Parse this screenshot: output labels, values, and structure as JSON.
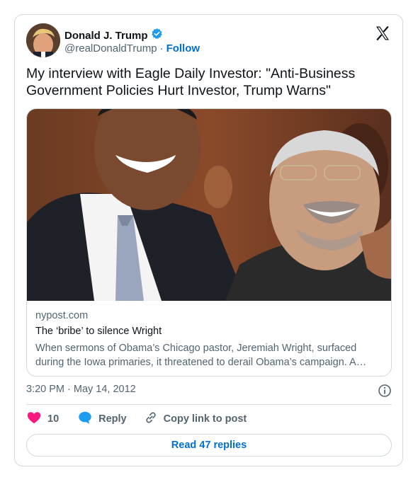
{
  "author": {
    "name": "Donald J. Trump",
    "handle": "@realDonaldTrump",
    "separator": "·",
    "follow_label": "Follow",
    "verified_color": "#1d9bf0"
  },
  "tweet": {
    "text": "My interview with Eagle Daily Investor: \"Anti-Business Government Policies Hurt Investor, Trump Warns\""
  },
  "link_card": {
    "domain": "nypost.com",
    "title": "The ‘bribe’ to silence Wright",
    "description": "When sermons of Obama’s Chicago pastor, Jeremiah Wright, surfaced during the Iowa primaries, it threatened to derail Obama’s campaign. A…"
  },
  "meta": {
    "timestamp": "3:20 PM · May 14, 2012"
  },
  "actions": {
    "like_count": "10",
    "reply_label": "Reply",
    "copy_label": "Copy link to post"
  },
  "footer": {
    "read_replies_label": "Read 47 replies"
  },
  "icons": {
    "platform": "x-logo-icon",
    "verified": "verified-badge-icon",
    "info": "info-icon",
    "like": "heart-icon",
    "reply": "reply-bubble-icon",
    "copy": "link-icon"
  },
  "colors": {
    "like": "#f91880",
    "reply": "#1d9bf0",
    "link": "#006fd6",
    "muted": "#536471",
    "border": "#cfd9de"
  }
}
